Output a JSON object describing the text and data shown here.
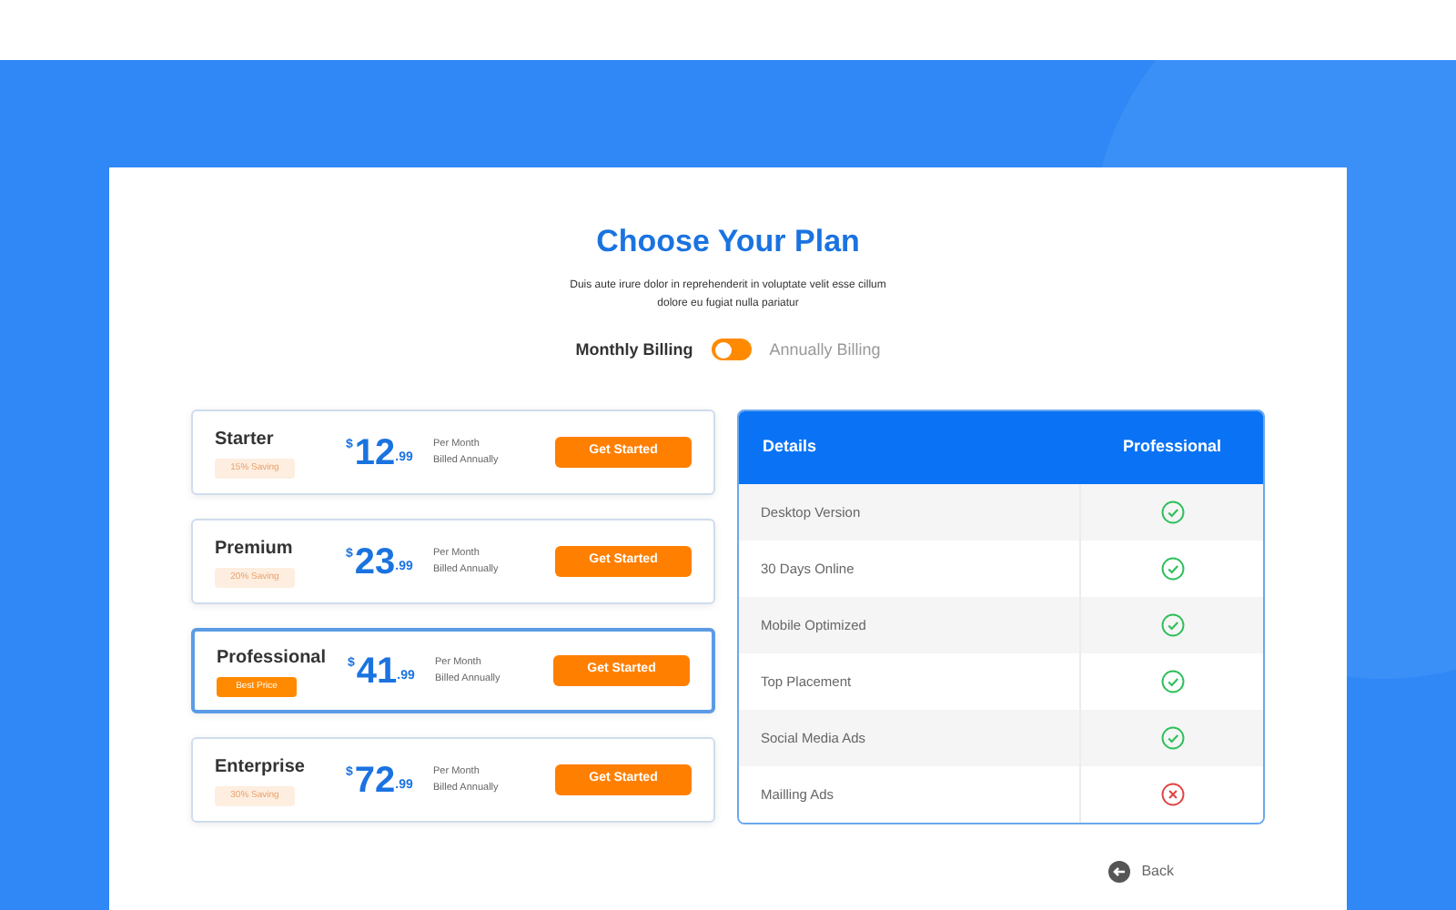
{
  "title": "Choose Your Plan",
  "subtitle": "Duis aute irure dolor in reprehenderit in voluptate velit esse cillum dolore eu fugiat nulla pariatur",
  "billing": {
    "monthly_label": "Monthly Billing",
    "annual_label": "Annually Billing",
    "annual": false
  },
  "plans": [
    {
      "name": "Starter",
      "badge": "15% Saving",
      "currency": "$",
      "price": "12",
      "cents": ".99",
      "period": "Per Month",
      "billing": "Billed Annually",
      "button": "Get Started",
      "selected": false
    },
    {
      "name": "Premium",
      "badge": "20% Saving",
      "currency": "$",
      "price": "23",
      "cents": ".99",
      "period": "Per Month",
      "billing": "Billed Annually",
      "button": "Get Started",
      "selected": false
    },
    {
      "name": "Professional",
      "badge": "Best Price",
      "currency": "$",
      "price": "41",
      "cents": ".99",
      "period": "Per Month",
      "billing": "Billed Annually",
      "button": "Get Started",
      "selected": true
    },
    {
      "name": "Enterprise",
      "badge": "30% Saving",
      "currency": "$",
      "price": "72",
      "cents": ".99",
      "period": "Per Month",
      "billing": "Billed Annually",
      "button": "Get Started",
      "selected": false
    }
  ],
  "table": {
    "columns": [
      "Details",
      "Professional"
    ],
    "rows": [
      {
        "feature": "Desktop Version",
        "included": true
      },
      {
        "feature": "30 Days Online",
        "included": true
      },
      {
        "feature": "Mobile Optimized",
        "included": true
      },
      {
        "feature": "Top Placement",
        "included": true
      },
      {
        "feature": "Social Media Ads",
        "included": true
      },
      {
        "feature": "Mailling Ads",
        "included": false
      }
    ]
  },
  "back": "Back"
}
